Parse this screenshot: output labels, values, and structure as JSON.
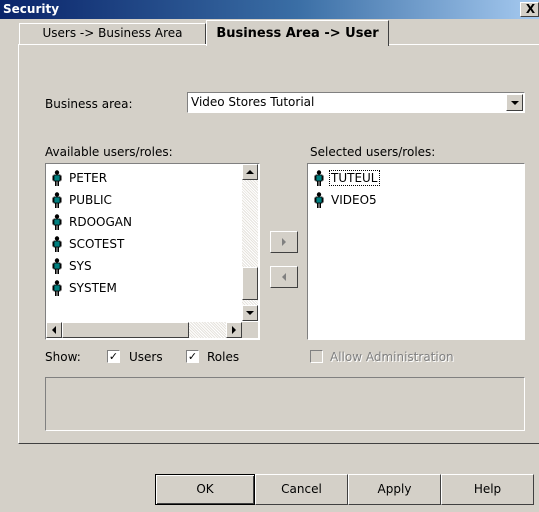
{
  "window": {
    "title": "Security",
    "close_glyph": "X"
  },
  "tabs": [
    {
      "label": "Users -> Business Area",
      "active": false
    },
    {
      "label": "Business Area -> User",
      "active": true
    }
  ],
  "business_area": {
    "label": "Business area:",
    "value": "Video Stores Tutorial"
  },
  "available": {
    "label": "Available users/roles:",
    "items": [
      "PETER",
      "PUBLIC",
      "RDOOGAN",
      "SCOTEST",
      "SYS",
      "SYSTEM"
    ],
    "icon": "user-figure-icon"
  },
  "selected": {
    "label": "Selected users/roles:",
    "items": [
      "TUTEUL",
      "VIDEO5"
    ],
    "icon": "user-figure-icon"
  },
  "show": {
    "label": "Show:",
    "users_label": "Users",
    "users_checked": true,
    "roles_label": "Roles",
    "roles_checked": true
  },
  "allow_admin": {
    "label": "Allow Administration",
    "checked": false,
    "enabled": false
  },
  "buttons": {
    "ok": "OK",
    "cancel": "Cancel",
    "apply": "Apply",
    "help": "Help"
  },
  "colors": {
    "title_start": "#0a246a",
    "title_end": "#a6caf0",
    "face": "#d4d0c8",
    "user_icon": "#008080"
  }
}
